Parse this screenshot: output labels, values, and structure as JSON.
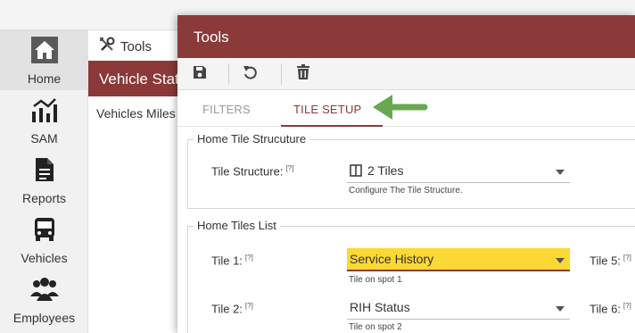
{
  "nav": {
    "items": [
      {
        "label": "Home",
        "icon": "home-icon"
      },
      {
        "label": "SAM",
        "icon": "chart-icon"
      },
      {
        "label": "Reports",
        "icon": "document-icon"
      },
      {
        "label": "Vehicles",
        "icon": "bus-icon"
      },
      {
        "label": "Employees",
        "icon": "people-icon"
      }
    ]
  },
  "page": {
    "breadcrumb": "Tools",
    "section_title": "Vehicle Status",
    "row_text": "Vehicles Miles"
  },
  "modal": {
    "title": "Tools",
    "toolbar": {
      "save_icon": "save-icon",
      "undo_icon": "undo-icon",
      "delete_icon": "trash-icon"
    },
    "tabs": [
      {
        "label": "FILTERS",
        "active": false
      },
      {
        "label": "TILE SETUP",
        "active": true
      }
    ],
    "tile_structure": {
      "legend": "Home Tile Strucuture",
      "label": "Tile Structure:",
      "help": "[?]",
      "value": "2 Tiles",
      "hint": "Configure The Tile Structure."
    },
    "tiles_list": {
      "legend": "Home Tiles List",
      "tiles": [
        {
          "label": "Tile 1:",
          "help": "[?]",
          "value": "Service History",
          "hint": "Tile on spot 1",
          "highlighted": true
        },
        {
          "label": "Tile 2:",
          "help": "[?]",
          "value": "RIH Status",
          "hint": "Tile on spot 2",
          "highlighted": false
        }
      ],
      "right_labels": [
        {
          "label": "Tile 5:",
          "help": "[?]"
        },
        {
          "label": "Tile 6:",
          "help": "[?]"
        }
      ]
    }
  },
  "colors": {
    "brand": "#8b3a3a",
    "highlight": "#fbd834",
    "arrow": "#6aa84f"
  }
}
